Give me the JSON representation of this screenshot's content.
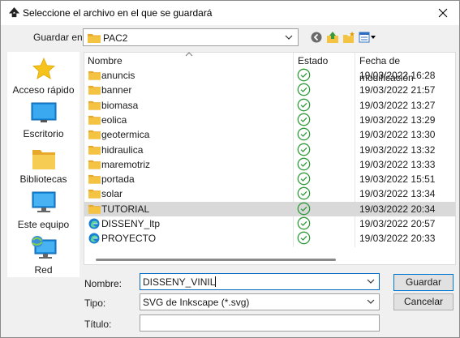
{
  "window": {
    "title": "Seleccione el archivo en el que se guardará"
  },
  "location": {
    "label": "Guardar en:",
    "value": "PAC2"
  },
  "places": [
    {
      "label": "Acceso rápido",
      "icon": "star-icon"
    },
    {
      "label": "Escritorio",
      "icon": "desktop-icon"
    },
    {
      "label": "Bibliotecas",
      "icon": "library-folder-icon"
    },
    {
      "label": "Este equipo",
      "icon": "computer-icon"
    },
    {
      "label": "Red",
      "icon": "network-icon"
    }
  ],
  "columns": {
    "name": "Nombre",
    "status": "Estado",
    "date": "Fecha de modificación"
  },
  "files": [
    {
      "name": "anuncis",
      "date": "19/03/2022 16:28",
      "type": "folder"
    },
    {
      "name": "banner",
      "date": "19/03/2022 21:57",
      "type": "folder"
    },
    {
      "name": "biomasa",
      "date": "19/03/2022 13:27",
      "type": "folder"
    },
    {
      "name": "eolica",
      "date": "19/03/2022 13:29",
      "type": "folder"
    },
    {
      "name": "geotermica",
      "date": "19/03/2022 13:30",
      "type": "folder"
    },
    {
      "name": "hidraulica",
      "date": "19/03/2022 13:32",
      "type": "folder"
    },
    {
      "name": "maremotriz",
      "date": "19/03/2022 13:33",
      "type": "folder"
    },
    {
      "name": "portada",
      "date": "19/03/2022 15:51",
      "type": "folder"
    },
    {
      "name": "solar",
      "date": "19/03/2022 13:34",
      "type": "folder"
    },
    {
      "name": "TUTORIAL",
      "date": "19/03/2022 20:34",
      "type": "folder",
      "selected": true
    },
    {
      "name": "DISSENY_ltp",
      "date": "19/03/2022 20:57",
      "type": "edge"
    },
    {
      "name": "PROYECTO",
      "date": "19/03/2022 20:33",
      "type": "edge"
    }
  ],
  "form": {
    "name_label": "Nombre:",
    "name_value": "DISSENY_VINIL",
    "type_label": "Tipo:",
    "type_value": "SVG de Inkscape (*.svg)",
    "title_label": "Título:",
    "title_value": ""
  },
  "buttons": {
    "save": "Guardar",
    "cancel": "Cancelar"
  },
  "colors": {
    "accent": "#0078d4",
    "sync_green": "#2e9a3a",
    "folder_yellow": "#f5c342",
    "selected_row": "#d9d9d9"
  }
}
